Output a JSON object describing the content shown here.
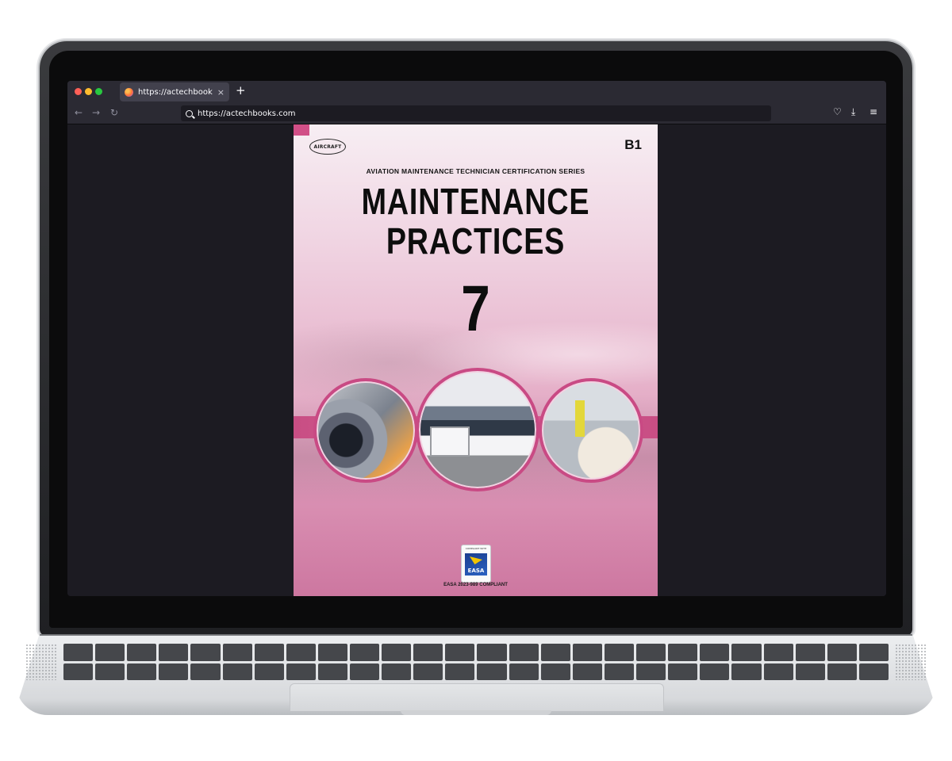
{
  "browser": {
    "tab_title": "https://actechbooks.com",
    "tab_close": "×",
    "new_tab": "+",
    "url": "https://actechbooks.com",
    "nav": {
      "back": "←",
      "forward": "→",
      "reload": "↻"
    },
    "toolbar": {
      "pocket": "♡",
      "download": "⤓",
      "menu": "≡"
    },
    "traffic_lights": [
      "#ff5f57",
      "#febc2e",
      "#28c840"
    ]
  },
  "cover": {
    "logo_text": "AIRCRAFT",
    "level_badge": "B1",
    "series": "AVIATION MAINTENANCE TECHNICIAN CERTIFICATION SERIES",
    "title_line1": "MAINTENANCE",
    "title_line2": "PRACTICES",
    "module_number": "7",
    "easa_caption": "COMPLIANT WITH",
    "easa_label": "EASA",
    "easa_note": "EASA 2023-989 COMPLIANT",
    "accent_color": "#c94a84"
  }
}
